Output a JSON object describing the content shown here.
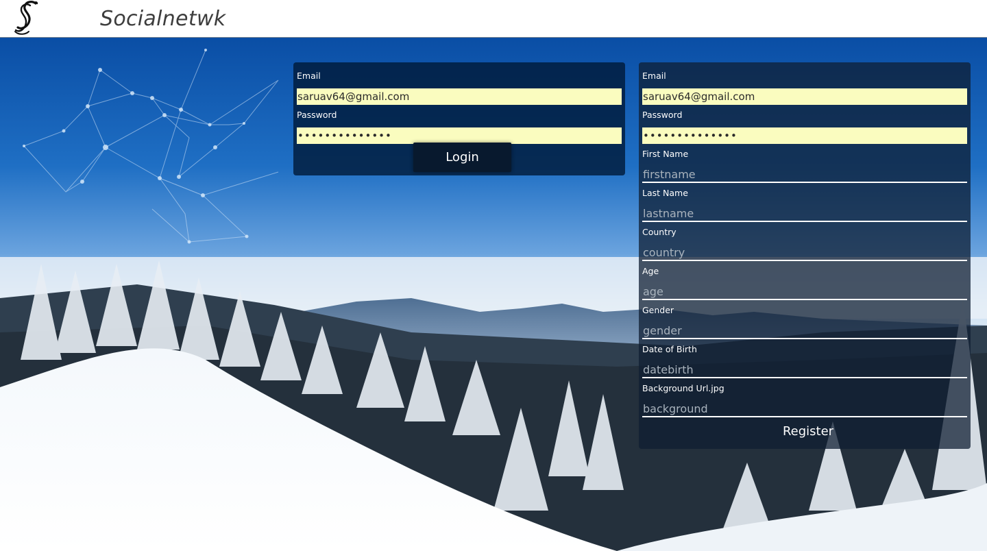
{
  "header": {
    "logo_text": "𝒮",
    "brand": "Socialnetwk"
  },
  "login": {
    "email_label": "Email",
    "email_value": "saruav64@gmail.com",
    "password_label": "Password",
    "password_value": "••••••••••••••",
    "button": "Login"
  },
  "register": {
    "email_label": "Email",
    "email_value": "saruav64@gmail.com",
    "password_label": "Password",
    "password_value": "••••••••••••••",
    "fields": [
      {
        "label": "First Name",
        "placeholder": "firstname"
      },
      {
        "label": "Last Name",
        "placeholder": "lastname"
      },
      {
        "label": "Country",
        "placeholder": "country"
      },
      {
        "label": "Age",
        "placeholder": "age"
      },
      {
        "label": "Gender",
        "placeholder": "gender"
      },
      {
        "label": "Date of Birth",
        "placeholder": "datebirth"
      },
      {
        "label": "Background Url.jpg",
        "placeholder": "background"
      }
    ],
    "button": "Register"
  },
  "colors": {
    "autofill_bg": "#fafcbf",
    "login_panel": "#00193a",
    "register_panel": "#0f1e32"
  }
}
